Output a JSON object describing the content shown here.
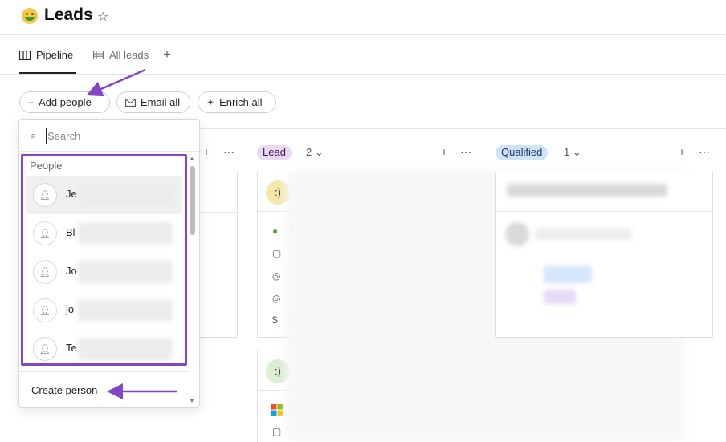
{
  "header": {
    "title": "Leads",
    "star_icon": "star-icon",
    "emoji_icon": "money-mouth-face-icon"
  },
  "tabs": [
    {
      "label": "Pipeline",
      "icon": "board-icon",
      "active": true
    },
    {
      "label": "All leads",
      "icon": "table-icon",
      "active": false
    }
  ],
  "tab_add": "+",
  "toolbar": {
    "add_people": "Add people",
    "email_all": "Email all",
    "enrich_all": "Enrich all"
  },
  "columns": [
    {
      "stage": "Lead",
      "count": "2",
      "color": "#ead8f6",
      "text_color": "#3b2352"
    },
    {
      "stage": "Qualified",
      "count": "1",
      "color": "#cfe4fb",
      "text_color": "#1c3552"
    }
  ],
  "dropdown": {
    "search_placeholder": "Search",
    "group_label": "People",
    "people": [
      {
        "name": "Je"
      },
      {
        "name": "Bl"
      },
      {
        "name": "Jo"
      },
      {
        "name": "jo"
      },
      {
        "name": "Te"
      }
    ],
    "create_label": "Create person"
  },
  "colors": {
    "annotation": "#8446c8",
    "accent": "#1f2328"
  }
}
